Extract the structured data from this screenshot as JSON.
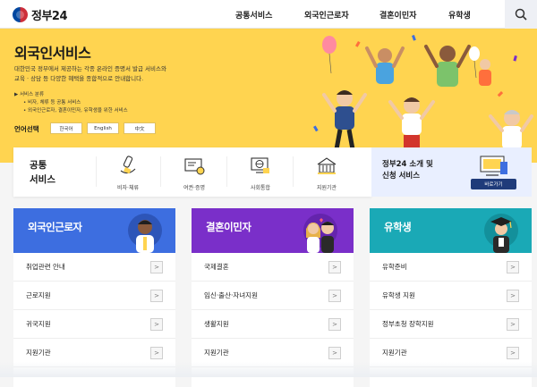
{
  "header": {
    "logo_text": "정부24",
    "nav": [
      "공통서비스",
      "외국인근로자",
      "결혼이민자",
      "유학생"
    ]
  },
  "hero": {
    "title": "외국인서비스",
    "desc_line1": "대한민국 정부에서 제공하는 각종 온라인 증명서 발급 서비스와",
    "desc_line2": "교육 · 상담 등 다양한 혜택을 종합적으로 안내합니다.",
    "category_head": "▶ 서비스 분류",
    "category_items": [
      "• 비자, 체류 등 공통 서비스",
      "• 외국인근로자, 결혼이민자, 유학생을 위한 서비스"
    ],
    "lang_label": "언어선택",
    "languages": [
      "한국어",
      "English",
      "中文"
    ]
  },
  "common": {
    "title_line1": "공통",
    "title_line2": "서비스",
    "items": [
      "비자·체류",
      "여권·증명",
      "사회통합",
      "지원기관"
    ]
  },
  "promo": {
    "line1": "정부24 소개 및",
    "line2": "신청 서비스",
    "button": "바로가기"
  },
  "cards": [
    {
      "title": "외국인근로자",
      "color": "#3d6ee0",
      "items": [
        "취업관련 안내",
        "근로지원",
        "귀국지원",
        "지원기관"
      ]
    },
    {
      "title": "결혼이민자",
      "color": "#7a2fc9",
      "items": [
        "국제결혼",
        "임신·출산·자녀지원",
        "생활지원",
        "지원기관"
      ]
    },
    {
      "title": "유학생",
      "color": "#1aa9b6",
      "items": [
        "유학준비",
        "유학생 지원",
        "정부초청 장학지원",
        "지원기관"
      ]
    }
  ],
  "arrow": ">"
}
